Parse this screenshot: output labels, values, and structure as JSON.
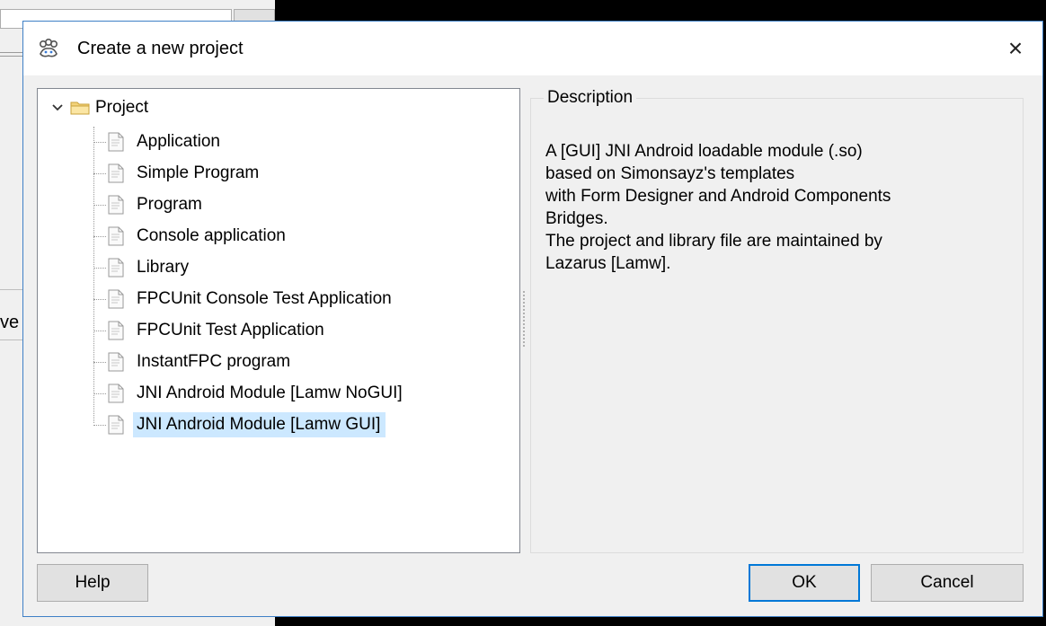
{
  "background": {
    "partial_text": "ve"
  },
  "dialog": {
    "title": "Create a new project",
    "title_icon": "lazarus-paw-icon",
    "close_label": "×"
  },
  "tree": {
    "root_label": "Project",
    "items": [
      {
        "label": "Application"
      },
      {
        "label": "Simple Program"
      },
      {
        "label": "Program"
      },
      {
        "label": "Console application"
      },
      {
        "label": "Library"
      },
      {
        "label": "FPCUnit Console Test Application"
      },
      {
        "label": "FPCUnit Test Application"
      },
      {
        "label": "InstantFPC program"
      },
      {
        "label": "JNI Android Module [Lamw NoGUI]"
      },
      {
        "label": "JNI Android Module [Lamw GUI]",
        "selected": true
      }
    ]
  },
  "description": {
    "legend": "Description",
    "lines": [
      "A [GUI] JNI Android loadable module (.so)",
      "based on Simonsayz's templates",
      "with Form Designer and Android Components",
      "Bridges.",
      "The project and library file are maintained by",
      "Lazarus [Lamw]."
    ]
  },
  "buttons": {
    "help": "Help",
    "ok": "OK",
    "cancel": "Cancel"
  },
  "colors": {
    "selection": "#cce8ff",
    "accent": "#0078d7",
    "dialog_border": "#3f80c6"
  }
}
